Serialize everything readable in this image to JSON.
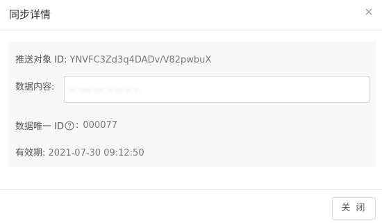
{
  "dialog": {
    "title": "同步详情",
    "close_icon": "close-icon"
  },
  "details": {
    "push_target_label": "推送对象 ID:",
    "push_target_value": "YNVFC3Zd3q4DADv/V82pwbuX",
    "data_content_label": "数据内容:",
    "data_content_value": "·· ····· ···· ·· ··· ·· ··",
    "data_unique_label": "数据唯一 ID",
    "data_unique_help_icon": "question-circle-icon",
    "data_unique_colon": ":",
    "data_unique_value": "000077",
    "validity_label": "有效期:",
    "validity_value": "2021-07-30 09:12:50"
  },
  "footer": {
    "close_button_label": "关 闭"
  }
}
